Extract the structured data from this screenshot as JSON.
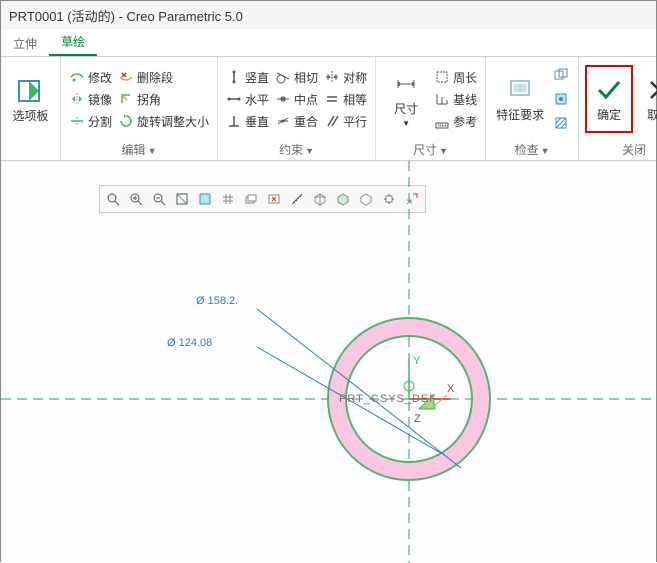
{
  "window": {
    "title": "PRT0001 (活动的) - Creo Parametric 5.0"
  },
  "tabs": {
    "extrude": "立伸",
    "sketch": "草绘"
  },
  "ribbon": {
    "panel_label": "选项板",
    "edit": {
      "label": "编辑",
      "modify": "修改",
      "delete_seg": "删除段",
      "mirror": "镜像",
      "corner": "拐角",
      "split": "分割",
      "rotate_resize": "旋转调整大小"
    },
    "constrain": {
      "label": "约束",
      "vertical": "竖直",
      "tangent": "相切",
      "symmetric": "对称",
      "horizontal": "水平",
      "midpoint": "中点",
      "equal": "相等",
      "perpendicular": "垂直",
      "coincident": "重合",
      "parallel": "平行"
    },
    "dimension": {
      "label": "尺寸",
      "dim": "尺寸",
      "perimeter": "周长",
      "baseline": "基线",
      "reference": "参考"
    },
    "inspect": {
      "label": "检查",
      "feature_req": "特征要求"
    },
    "close": {
      "label": "关闭",
      "ok": "确定",
      "cancel": "取消"
    }
  },
  "sketch": {
    "dim1_label": "Ø 158.2.",
    "dim2_label": "Ø 124.08",
    "csys_name": "PRT_CSYS_DEF",
    "axis_x": "X",
    "axis_y": "Y",
    "axis_z": "Z",
    "outer_diameter": 158.2,
    "inner_diameter": 124.08
  },
  "colors": {
    "accent": "#0b7f3f",
    "highlight": "#e60000",
    "pink": "#fbc6e1",
    "circle": "#54b36e",
    "axis_teal": "#2f9290",
    "axis_red": "#b03a2e",
    "dim_blue": "#2a7fa8"
  }
}
